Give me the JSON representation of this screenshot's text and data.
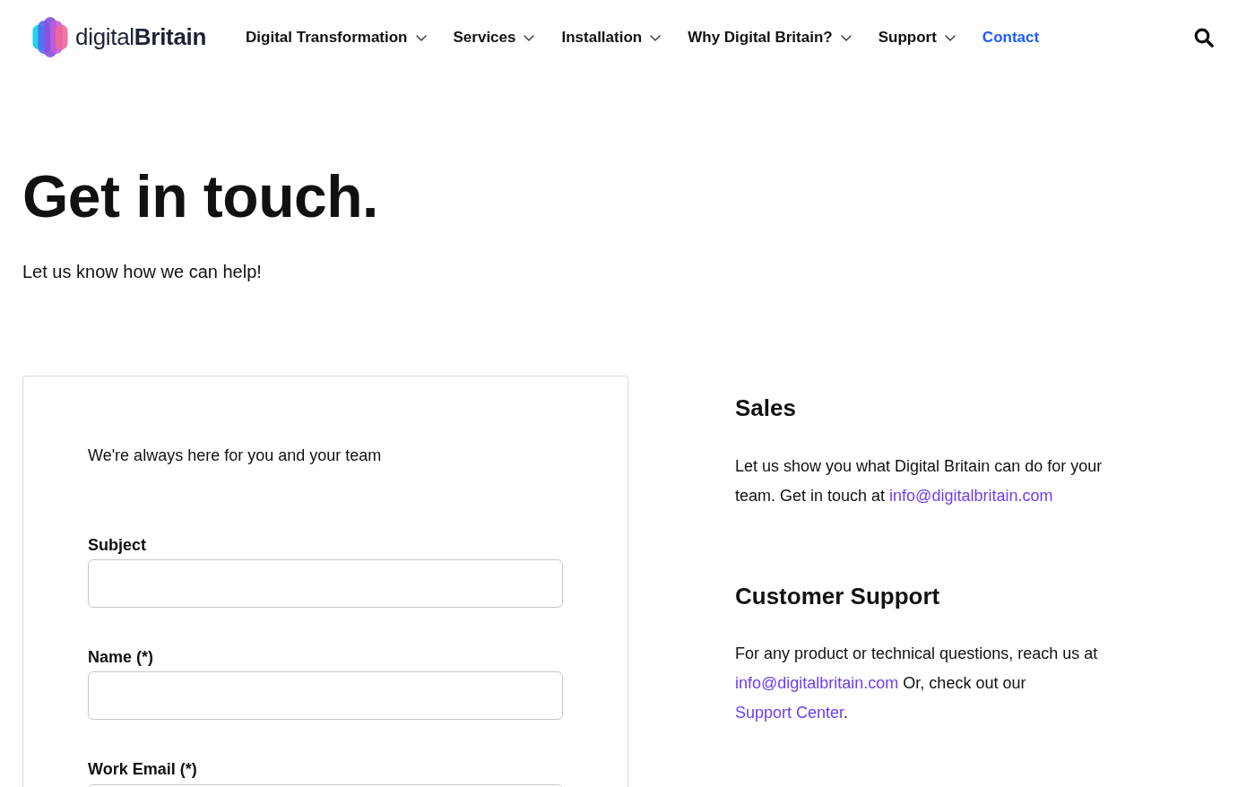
{
  "header": {
    "logo": "digital**Britain**",
    "nav": [
      {
        "label": "Digital Transformation",
        "dropdown": true,
        "selected": false
      },
      {
        "label": "Services",
        "dropdown": true,
        "selected": false
      },
      {
        "label": "Installation",
        "dropdown": true,
        "selected": false
      },
      {
        "label": "Why Digital Britain?",
        "dropdown": true,
        "selected": false
      },
      {
        "label": "Support",
        "dropdown": true,
        "selected": false
      },
      {
        "label": "Contact",
        "dropdown": false,
        "selected": true
      }
    ]
  },
  "hero": {
    "title": "Get in touch.",
    "subtitle": "Let us know how we can help!"
  },
  "form": {
    "intro": "We're always here for you and your team",
    "fields": [
      {
        "label": "Subject"
      },
      {
        "label": "Name (*)"
      },
      {
        "label": "Work Email (*)"
      }
    ]
  },
  "contacts": [
    {
      "title": "Sales",
      "text": [
        {
          "kind": "text",
          "text": "Let us show you what Digital Britain can do for your team. Get in touch at "
        },
        {
          "kind": "link",
          "text": "info@digitalbritain.com"
        }
      ]
    },
    {
      "title": "Customer Support",
      "text": [
        {
          "kind": "text",
          "text": "For any product or technical questions, reach us at "
        },
        {
          "kind": "link",
          "text": "info@digitalbritain.com"
        },
        {
          "kind": "text",
          "text": " Or, check out our "
        },
        {
          "kind": "link",
          "text": "Support Center"
        },
        {
          "kind": "text",
          "text": "."
        }
      ]
    }
  ]
}
